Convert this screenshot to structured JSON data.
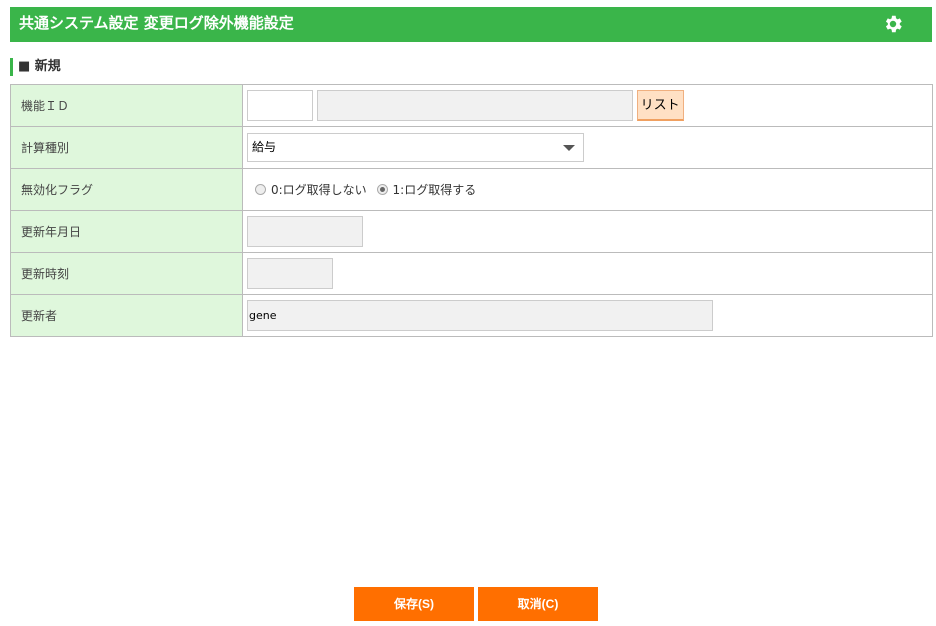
{
  "header": {
    "title": "共通システム設定 変更ログ除外機能設定",
    "settings_icon": "gear-icon"
  },
  "section": {
    "title": "■ 新規"
  },
  "form": {
    "function_id": {
      "label": "機能ＩＤ",
      "value": "",
      "name_value": "",
      "list_button": "リスト"
    },
    "calc_type": {
      "label": "計算種別",
      "selected": "給与"
    },
    "disable_flag": {
      "label": "無効化フラグ",
      "options": [
        "0:ログ取得しない",
        "1:ログ取得する"
      ],
      "selected": "1:ログ取得する"
    },
    "update_date": {
      "label": "更新年月日",
      "value": ""
    },
    "update_time": {
      "label": "更新時刻",
      "value": ""
    },
    "updater": {
      "label": "更新者",
      "value": "gene"
    }
  },
  "footer": {
    "save": "保存(S)",
    "cancel": "取消(C)"
  },
  "colors": {
    "header": "#3ab54a",
    "label_bg": "#dff7dc",
    "button": "#ff6f00"
  }
}
